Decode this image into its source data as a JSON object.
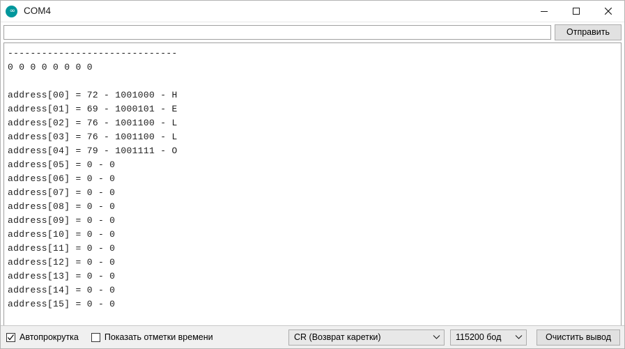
{
  "window": {
    "title": "COM4",
    "icon": "arduino-logo-icon",
    "accent_color": "#00979c",
    "controls": {
      "minimize": "minimize-icon",
      "maximize": "maximize-icon",
      "close": "close-icon"
    }
  },
  "send_row": {
    "input_value": "",
    "input_placeholder": "",
    "send_label": "Отправить"
  },
  "console": {
    "lines": [
      "------------------------------",
      "0 0 0 0 0 0 0 0",
      "",
      "address[00] = 72 - 1001000 - H",
      "address[01] = 69 - 1000101 - E",
      "address[02] = 76 - 1001100 - L",
      "address[03] = 76 - 1001100 - L",
      "address[04] = 79 - 1001111 - O",
      "address[05] = 0 - 0",
      "address[06] = 0 - 0",
      "address[07] = 0 - 0",
      "address[08] = 0 - 0",
      "address[09] = 0 - 0",
      "address[10] = 0 - 0",
      "address[11] = 0 - 0",
      "address[12] = 0 - 0",
      "address[13] = 0 - 0",
      "address[14] = 0 - 0",
      "address[15] = 0 - 0"
    ]
  },
  "bottom_bar": {
    "autoscroll_label": "Автопрокрутка",
    "autoscroll_checked": true,
    "timestamp_label": "Показать отметки времени",
    "timestamp_checked": false,
    "line_ending_value": "CR (Возврат каретки)",
    "baud_rate_value": "115200 бод",
    "clear_label": "Очистить вывод"
  }
}
